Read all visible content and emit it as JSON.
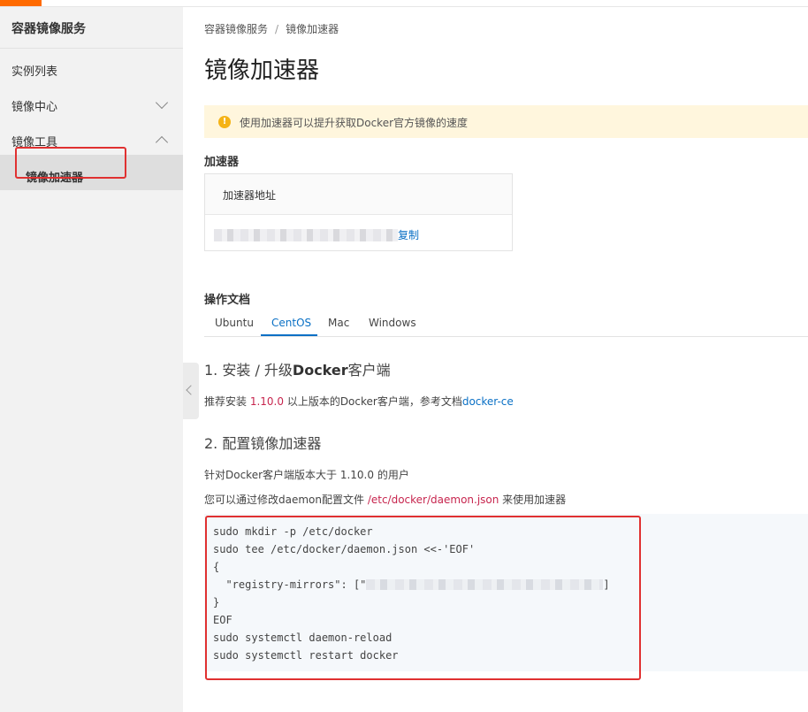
{
  "sidebar": {
    "title": "容器镜像服务",
    "items": [
      {
        "label": "实例列表"
      },
      {
        "label": "镜像中心"
      },
      {
        "label": "镜像工具"
      },
      {
        "label": "镜像加速器"
      }
    ]
  },
  "breadcrumb": {
    "root": "容器镜像服务",
    "separator": "/",
    "current": "镜像加速器"
  },
  "page_title": "镜像加速器",
  "notice": {
    "icon": "warning-icon",
    "glyph": "!",
    "text": "使用加速器可以提升获取Docker官方镜像的速度"
  },
  "accelerator": {
    "section_title": "加速器",
    "column_header": "加速器地址",
    "copy_label": "复制"
  },
  "docs": {
    "section_title": "操作文档",
    "tabs": [
      {
        "label": "Ubuntu"
      },
      {
        "label": "CentOS"
      },
      {
        "label": "Mac"
      },
      {
        "label": "Windows"
      }
    ],
    "active_tab": "CentOS",
    "step1": {
      "title_prefix": "1. 安装 / 升级",
      "title_bold": "Docker",
      "title_suffix": "客户端",
      "text_prefix": "推荐安装 ",
      "version": "1.10.0",
      "text_middle": " 以上版本的Docker客户端，参考文档",
      "link": "docker-ce"
    },
    "step2": {
      "title": "2. 配置镜像加速器",
      "line1": "针对Docker客户端版本大于 1.10.0 的用户",
      "line2_prefix": "您可以通过修改daemon配置文件 ",
      "config_path": "/etc/docker/daemon.json",
      "line2_suffix": " 来使用加速器"
    },
    "code": {
      "line1": "sudo mkdir -p /etc/docker",
      "line2": "sudo tee /etc/docker/daemon.json <<-'EOF'",
      "line3": "{",
      "line4_prefix": "  \"registry-mirrors\": [\"",
      "line4_suffix": "]",
      "line5": "}",
      "line6": "EOF",
      "line7": "sudo systemctl daemon-reload",
      "line8": "sudo systemctl restart docker"
    }
  },
  "colors": {
    "accent": "#ff6a00",
    "link": "#0a70c5",
    "highlight_box": "#e03131",
    "notice_bg": "#fff6dd"
  }
}
